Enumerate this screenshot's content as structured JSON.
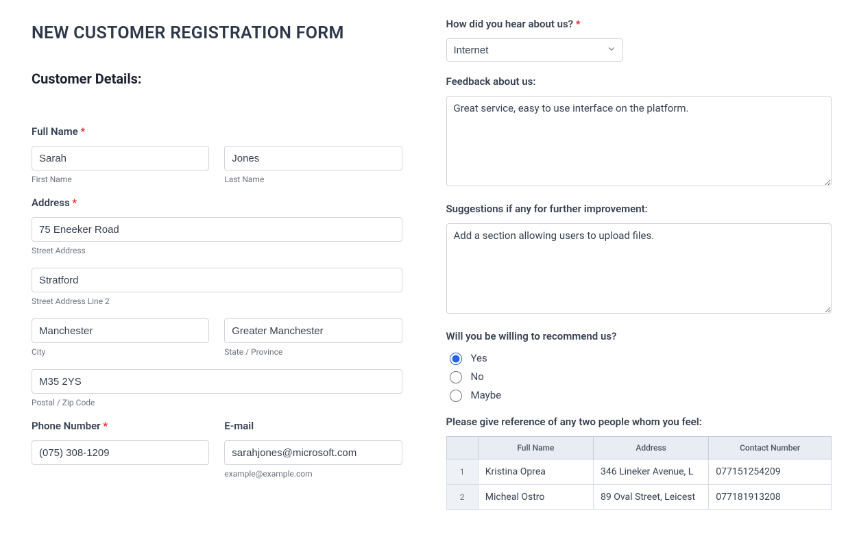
{
  "title": "NEW CUSTOMER REGISTRATION FORM",
  "sectionHeading": "Customer Details:",
  "fullName": {
    "label": "Full Name",
    "required": "*",
    "first": {
      "value": "Sarah",
      "sub": "First Name"
    },
    "last": {
      "value": "Jones",
      "sub": "Last Name"
    }
  },
  "address": {
    "label": "Address",
    "required": "*",
    "street": {
      "value": "75 Eneeker Road",
      "sub": "Street Address"
    },
    "street2": {
      "value": "Stratford",
      "sub": "Street Address Line 2"
    },
    "city": {
      "value": "Manchester",
      "sub": "City"
    },
    "state": {
      "value": "Greater Manchester",
      "sub": "State / Province"
    },
    "postal": {
      "value": "M35 2YS",
      "sub": "Postal / Zip Code"
    }
  },
  "phone": {
    "label": "Phone Number",
    "required": "*",
    "value": "(075) 308-1209"
  },
  "email": {
    "label": "E-mail",
    "value": "sarahjones@microsoft.com",
    "sub": "example@example.com"
  },
  "hearAbout": {
    "label": "How did you hear about us?",
    "required": "*",
    "selected": "Internet"
  },
  "feedback": {
    "label": "Feedback about us:",
    "value": "Great service, easy to use interface on the platform."
  },
  "suggestions": {
    "label": "Suggestions if any for further improvement:",
    "value": "Add a section allowing users to upload files."
  },
  "recommend": {
    "label": "Will you be willing to recommend us?",
    "options": {
      "yes": "Yes",
      "no": "No",
      "maybe": "Maybe"
    },
    "selected": "yes"
  },
  "references": {
    "label": "Please give reference of any two people whom you feel:",
    "headers": {
      "name": "Full Name",
      "address": "Address",
      "contact": "Contact Number"
    },
    "rows": [
      {
        "num": "1",
        "name": "Kristina Oprea",
        "address": "346 Lineker Avenue, L",
        "contact": "077151254209"
      },
      {
        "num": "2",
        "name": "Micheal Ostro",
        "address": "89 Oval Street, Leicest",
        "contact": "077181913208"
      }
    ]
  }
}
